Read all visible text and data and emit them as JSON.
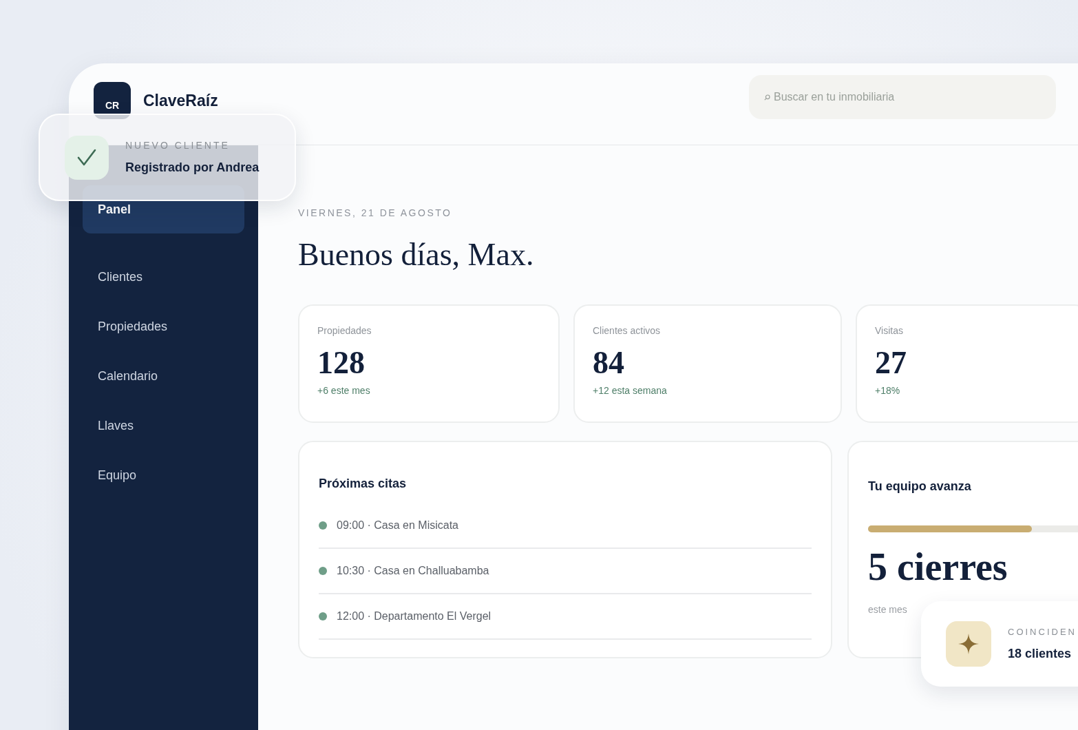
{
  "brand": {
    "logo": "CR",
    "name": "ClaveRaíz"
  },
  "search": {
    "placeholder": "Buscar en tu inmobiliaria"
  },
  "toast": {
    "eyebrow": "NUEVO CLIENTE",
    "message": "Registrado por Andrea"
  },
  "sidebar": {
    "items": [
      {
        "label": "Panel",
        "selected": true
      },
      {
        "label": "Clientes",
        "selected": false
      },
      {
        "label": "Propiedades",
        "selected": false
      },
      {
        "label": "Calendario",
        "selected": false
      },
      {
        "label": "Llaves",
        "selected": false
      },
      {
        "label": "Equipo",
        "selected": false
      }
    ]
  },
  "date": "VIERNES, 21 DE AGOSTO",
  "greeting": "Buenos días, Max.",
  "stats": [
    {
      "label": "Propiedades",
      "value": "128",
      "delta": "+6 este mes"
    },
    {
      "label": "Clientes activos",
      "value": "84",
      "delta": "+12 esta semana"
    },
    {
      "label": "Visitas",
      "value": "27",
      "delta": "+18%"
    }
  ],
  "appointments": {
    "title": "Próximas citas",
    "items": [
      {
        "text": "09:00 · Casa en Misicata"
      },
      {
        "text": "10:30 · Casa en Challuabamba"
      },
      {
        "text": "12:00 · Departamento El Vergel"
      }
    ]
  },
  "team": {
    "title": "Tu equipo avanza",
    "level": 0.7,
    "value": "5 cierres",
    "caption": "este mes"
  },
  "matches": {
    "eyebrow": "COINCIDEN",
    "text": "18 clientes"
  }
}
